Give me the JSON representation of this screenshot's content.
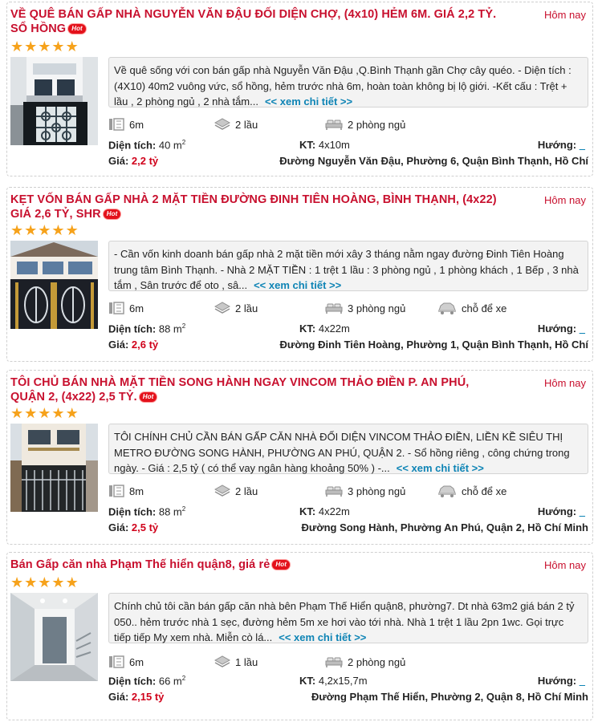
{
  "listings": [
    {
      "title": "VỀ QUÊ BÁN GẤP NHÀ NGUYỄN VĂN ĐẬU ĐỐI DIỆN CHỢ, (4x10) HẺM 6M. GIÁ 2,2 TỶ. SỔ HỒNG",
      "badge": "Hot",
      "date": "Hôm nay",
      "rating": 5,
      "description": "Về quê sống với con bán gấp nhà Nguyễn Văn Đậu ,Q.Bình Thạnh gần Chợ cây quéo. - Diện tích : (4X10) 40m2 vuông vức, sổ hồng, hẻm trước nhà 6m, hoàn toàn không bị lộ giới. -Kết cấu : Trệt + lầu , 2 phòng ngủ , 2 nhà tắm...",
      "more": "<< xem chi tiết >>",
      "road": "6m",
      "floors": "2 lầu",
      "bedrooms": "2 phòng ngủ",
      "parking": null,
      "area_label": "Diện tích:",
      "area": "40 m",
      "size_label": "KT:",
      "size": "4x10m",
      "direction_label": "Hướng:",
      "direction": "_",
      "price_label": "Giá:",
      "price": "2,2 tỷ",
      "address": "Đường Nguyễn Văn Đậu, Phường 6, Quận Bình Thạnh, Hồ Chí"
    },
    {
      "title": "KẸT VỐN BÁN GẤP NHÀ 2 MẶT TIỀN ĐƯỜNG ĐINH TIÊN HOÀNG, BÌNH THẠNH, (4x22) GIÁ 2,6 TỶ, SHR",
      "badge": "Hot",
      "date": "Hôm nay",
      "rating": 5,
      "description": "- Cần vốn kinh doanh bán gấp nhà 2 mặt tiền mới xây 3 tháng nằm ngay đường Đinh Tiên Hoàng trung tâm Bình Thạnh. - Nhà 2 MẶT TIỀN : 1 trệt 1 lầu : 3 phòng ngủ , 1 phòng khách , 1 Bếp , 3 nhà tắm , Sân trước để oto , sâ...",
      "more": "<< xem chi tiết >>",
      "road": "6m",
      "floors": "2 lầu",
      "bedrooms": "3 phòng ngủ",
      "parking": "chỗ để xe",
      "area_label": "Diện tích:",
      "area": "88 m",
      "size_label": "KT:",
      "size": "4x22m",
      "direction_label": "Hướng:",
      "direction": "_",
      "price_label": "Giá:",
      "price": "2,6 tỷ",
      "address": "Đường Đinh Tiên Hoàng, Phường 1, Quận Bình Thạnh, Hồ Chí"
    },
    {
      "title": "TÔI CHỦ BÁN NHÀ MẶT TIỀN SONG HÀNH NGAY VINCOM THẢO ĐIỀN P. AN PHÚ, QUẬN 2, (4x22) 2,5 TỶ.",
      "badge": "Hot",
      "date": "Hôm nay",
      "rating": 5,
      "description": "TÔI CHÍNH CHỦ CẦN BÁN GẤP CĂN NHÀ ĐỐI DIỆN VINCOM THẢO ĐIỀN, LIỀN KỀ SIÊU THỊ METRO ĐƯỜNG SONG HÀNH, PHƯỜNG AN PHÚ, QUẬN 2. - Sổ hồng riêng , công chứng trong ngày. - Giá : 2,5 tỷ ( có thể vay ngân hàng khoảng 50% ) -...",
      "more": "<< xem chi tiết >>",
      "road": "8m",
      "floors": "2 lầu",
      "bedrooms": "3 phòng ngủ",
      "parking": "chỗ để xe",
      "area_label": "Diện tích:",
      "area": "88 m",
      "size_label": "KT:",
      "size": "4x22m",
      "direction_label": "Hướng:",
      "direction": "_",
      "price_label": "Giá:",
      "price": "2,5 tỷ",
      "address": "Đường Song Hành, Phường An Phú, Quận 2, Hồ Chí Minh"
    },
    {
      "title": "Bán Gấp căn nhà Phạm Thế hiển quận8, giá rẻ",
      "badge": "Hot",
      "date": "Hôm nay",
      "rating": 5,
      "description": "Chính chủ tôi cần bán gấp căn nhà bên Phạm Thế Hiển quận8, phường7. Dt nhà 63m2 giá bán 2 tỷ 050.. hẻm trước nhà 1 sẹc, đường hẻm 5m xe hơi vào tới nhà. Nhà 1 trệt 1 lầu 2pn 1wc. Gọi trực tiếp tiếp My xem nhà. Miễn cò lá...",
      "more": "<< xem chi tiết >>",
      "road": "6m",
      "floors": "1 lầu",
      "bedrooms": "2 phòng ngủ",
      "parking": null,
      "area_label": "Diện tích:",
      "area": "66 m",
      "size_label": "KT:",
      "size": "4,2x15,7m",
      "direction_label": "Hướng:",
      "direction": "_",
      "price_label": "Giá:",
      "price": "2,15 tỷ",
      "address": "Đường Phạm Thế Hiển, Phường 2, Quận 8, Hồ Chí Minh"
    }
  ],
  "area_unit_sup": "2",
  "colors": {
    "title": "#c8102e",
    "price": "#d0021b",
    "link": "#0e84b5",
    "star": "#f6a21b"
  }
}
